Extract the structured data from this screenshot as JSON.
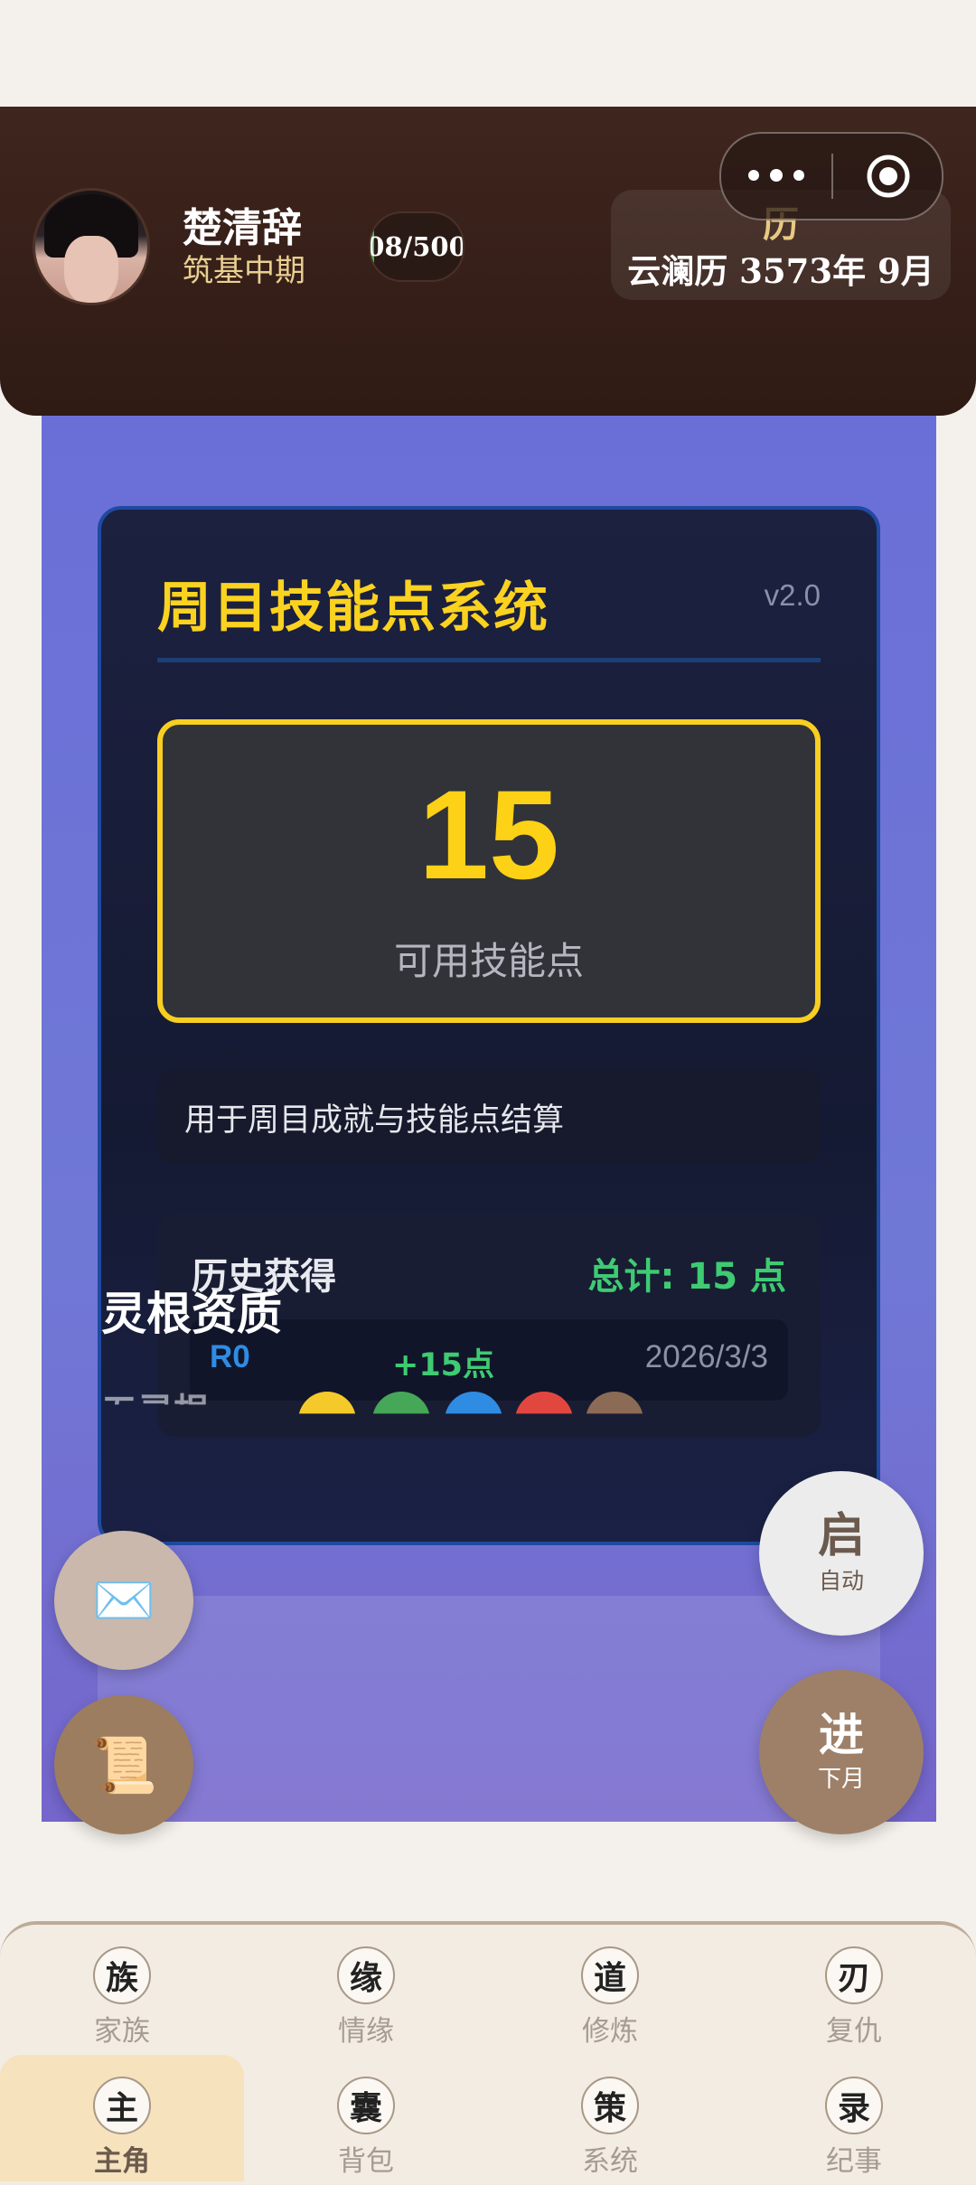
{
  "header": {
    "character_name": "楚清辞",
    "realm": "筑基中期",
    "exp": "08/500",
    "exp_fraction": 0.016,
    "calendar_icon": "历",
    "calendar_date": "云澜历 3573年 9月"
  },
  "mini_program_capsule": {
    "menu_icon": "more-dots-icon",
    "close_icon": "target-icon"
  },
  "skill_card": {
    "title": "周目技能点系统",
    "version": "v2.0",
    "points_value": "15",
    "points_label": "可用技能点",
    "description": "用于周目成就与技能点结算",
    "history_title": "历史获得",
    "history_total": "总计: 15 点",
    "history_rows": [
      {
        "round": "R0",
        "points": "+15点",
        "date": "2026/3/3"
      }
    ]
  },
  "next_card": {
    "title": "灵根资质",
    "subtitle": "五灵根"
  },
  "fabs": {
    "auto_big": "启",
    "auto_small": "自动",
    "next_big": "进",
    "next_small": "下月",
    "mail_icon": "✉️",
    "scroll_icon": "📜"
  },
  "tabs": [
    {
      "glyph": "族",
      "label": "家族"
    },
    {
      "glyph": "缘",
      "label": "情缘"
    },
    {
      "glyph": "道",
      "label": "修炼"
    },
    {
      "glyph": "刃",
      "label": "复仇"
    },
    {
      "glyph": "主",
      "label": "主角",
      "active": true
    },
    {
      "glyph": "囊",
      "label": "背包"
    },
    {
      "glyph": "策",
      "label": "系统"
    },
    {
      "glyph": "录",
      "label": "纪事"
    }
  ],
  "colors": {
    "accent_gold": "#fbd21f",
    "green": "#3ecb72",
    "blue": "#2f8ce3",
    "header_brown": "#3f261e"
  }
}
